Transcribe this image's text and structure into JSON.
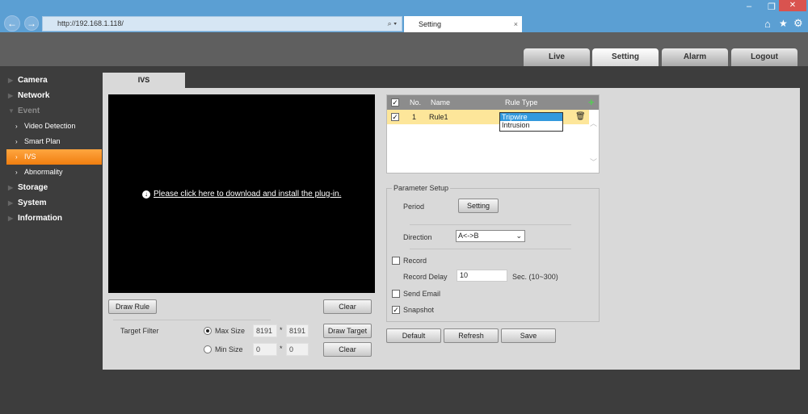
{
  "browser": {
    "url": "http://192.168.1.118/",
    "tab_title": "Setting",
    "minimize": "–",
    "restore": "❐",
    "close": "✕",
    "home_icon": "⌂",
    "star_icon": "★",
    "gear_icon": "⚙",
    "back": "←",
    "forward": "→",
    "search_icon": "⌕ ▾",
    "refresh_icon": "↻"
  },
  "top_tabs": [
    {
      "label": "Live"
    },
    {
      "label": "Setting"
    },
    {
      "label": "Alarm"
    },
    {
      "label": "Logout"
    }
  ],
  "sidebar": {
    "items": [
      {
        "label": "Camera"
      },
      {
        "label": "Network"
      },
      {
        "label": "Event"
      },
      {
        "label": "Video Detection"
      },
      {
        "label": "Smart Plan"
      },
      {
        "label": "IVS"
      },
      {
        "label": "Abnormality"
      },
      {
        "label": "Storage"
      },
      {
        "label": "System"
      },
      {
        "label": "Information"
      }
    ]
  },
  "page_tab": "IVS",
  "video": {
    "plugin_text": "Please click here to download and install the plug-in."
  },
  "buttons": {
    "draw_rule": "Draw Rule",
    "clear": "Clear",
    "draw_target": "Draw Target",
    "clear2": "Clear",
    "default": "Default",
    "refresh": "Refresh",
    "save": "Save",
    "period_setting": "Setting"
  },
  "target_filter": {
    "label": "Target Filter",
    "max_label": "Max Size",
    "max_w": "8191",
    "max_h": "8191",
    "min_label": "Min Size",
    "min_w": "0",
    "min_h": "0",
    "sep": "*",
    "selected": "Max Size"
  },
  "rules": {
    "headers": {
      "no": "No.",
      "name": "Name",
      "type": "Rule Type"
    },
    "rows": [
      {
        "checked": true,
        "no": "1",
        "name": "Rule1"
      }
    ],
    "type_options": [
      "Tripwire",
      "Intrusion"
    ],
    "type_selected": "Tripwire"
  },
  "params": {
    "legend": "Parameter Setup",
    "period": "Period",
    "direction": "Direction",
    "direction_value": "A<->B",
    "record": "Record",
    "record_checked": false,
    "record_delay": "Record Delay",
    "record_delay_value": "10",
    "record_delay_unit": "Sec. (10~300)",
    "send_email": "Send Email",
    "send_email_checked": false,
    "snapshot": "Snapshot",
    "snapshot_checked": true
  }
}
